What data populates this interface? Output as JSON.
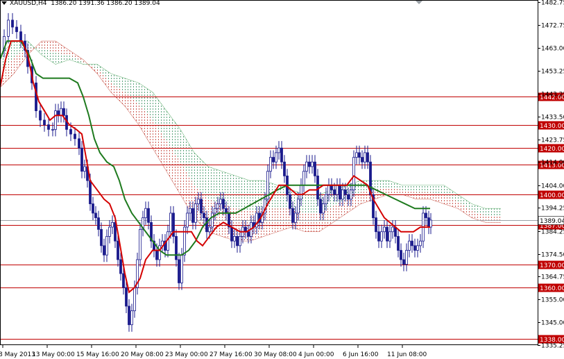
{
  "header": {
    "symbol": "XAUUSD,H4",
    "ohlc": "1386.20 1391.36 1386.20 1389.04"
  },
  "chart_data": {
    "type": "candlestick",
    "title": "XAUUSD,H4",
    "ylim": [
      1335.25,
      1482.75
    ],
    "price_ticks": [
      1482.75,
      1472.75,
      1463.0,
      1453.25,
      1443.25,
      1433.5,
      1423.75,
      1414.0,
      1404.0,
      1394.25,
      1384.25,
      1374.5,
      1364.75,
      1355.0,
      1345.0,
      1335.25
    ],
    "time_labels": [
      "8 May 2013",
      "13 May 00:00",
      "15 May 16:00",
      "20 May 08:00",
      "23 May 00:00",
      "27 May 16:00",
      "30 May 08:00",
      "4 Jun 00:00",
      "6 Jun 16:00",
      "11 Jun 08:00"
    ],
    "horizontal_levels": [
      {
        "price": 1442.0,
        "label": "1442.00"
      },
      {
        "price": 1430.0,
        "label": "1430.00"
      },
      {
        "price": 1420.0,
        "label": "1420.00"
      },
      {
        "price": 1413.0,
        "label": "1413.00"
      },
      {
        "price": 1400.0,
        "label": "1400.00"
      },
      {
        "price": 1387.0,
        "label": "1387.00"
      },
      {
        "price": 1370.0,
        "label": "1370.00"
      },
      {
        "price": 1360.0,
        "label": "1360.00"
      },
      {
        "price": 1338.0,
        "label": "1338.00"
      }
    ],
    "current_price": {
      "price": 1389.04,
      "label": "1389.04"
    },
    "close_path": [
      [
        0,
        1462
      ],
      [
        6,
        1468
      ],
      [
        12,
        1475
      ],
      [
        18,
        1472
      ],
      [
        24,
        1470
      ],
      [
        30,
        1466
      ],
      [
        36,
        1462
      ],
      [
        40,
        1455
      ],
      [
        46,
        1448
      ],
      [
        52,
        1436
      ],
      [
        58,
        1432
      ],
      [
        64,
        1430
      ],
      [
        70,
        1428
      ],
      [
        76,
        1428
      ],
      [
        80,
        1436
      ],
      [
        84,
        1434
      ],
      [
        88,
        1437
      ],
      [
        92,
        1434
      ],
      [
        96,
        1428
      ],
      [
        102,
        1426
      ],
      [
        108,
        1424
      ],
      [
        114,
        1420
      ],
      [
        118,
        1410
      ],
      [
        122,
        1412
      ],
      [
        126,
        1406
      ],
      [
        130,
        1396
      ],
      [
        134,
        1392
      ],
      [
        138,
        1390
      ],
      [
        142,
        1385
      ],
      [
        146,
        1378
      ],
      [
        150,
        1374
      ],
      [
        154,
        1382
      ],
      [
        158,
        1386
      ],
      [
        162,
        1388
      ],
      [
        166,
        1380
      ],
      [
        170,
        1372
      ],
      [
        174,
        1366
      ],
      [
        178,
        1360
      ],
      [
        182,
        1352
      ],
      [
        186,
        1344
      ],
      [
        190,
        1350
      ],
      [
        194,
        1360
      ],
      [
        198,
        1372
      ],
      [
        202,
        1385
      ],
      [
        206,
        1390
      ],
      [
        210,
        1394
      ],
      [
        214,
        1388
      ],
      [
        218,
        1380
      ],
      [
        222,
        1376
      ],
      [
        226,
        1372
      ],
      [
        230,
        1378
      ],
      [
        234,
        1380
      ],
      [
        238,
        1376
      ],
      [
        242,
        1384
      ],
      [
        246,
        1392
      ],
      [
        250,
        1382
      ],
      [
        254,
        1372
      ],
      [
        258,
        1362
      ],
      [
        262,
        1374
      ],
      [
        266,
        1386
      ],
      [
        270,
        1392
      ],
      [
        274,
        1394
      ],
      [
        278,
        1388
      ],
      [
        282,
        1396
      ],
      [
        286,
        1398
      ],
      [
        290,
        1392
      ],
      [
        294,
        1390
      ],
      [
        298,
        1384
      ],
      [
        302,
        1386
      ],
      [
        306,
        1392
      ],
      [
        310,
        1394
      ],
      [
        314,
        1396
      ],
      [
        318,
        1398
      ],
      [
        322,
        1394
      ],
      [
        326,
        1392
      ],
      [
        330,
        1386
      ],
      [
        334,
        1380
      ],
      [
        338,
        1382
      ],
      [
        342,
        1378
      ],
      [
        346,
        1382
      ],
      [
        350,
        1386
      ],
      [
        354,
        1384
      ],
      [
        358,
        1382
      ],
      [
        362,
        1388
      ],
      [
        366,
        1386
      ],
      [
        370,
        1392
      ],
      [
        374,
        1388
      ],
      [
        378,
        1392
      ],
      [
        382,
        1398
      ],
      [
        386,
        1410
      ],
      [
        390,
        1416
      ],
      [
        394,
        1414
      ],
      [
        398,
        1418
      ],
      [
        402,
        1420
      ],
      [
        406,
        1414
      ],
      [
        410,
        1408
      ],
      [
        414,
        1400
      ],
      [
        418,
        1394
      ],
      [
        422,
        1388
      ],
      [
        426,
        1392
      ],
      [
        430,
        1398
      ],
      [
        434,
        1404
      ],
      [
        438,
        1410
      ],
      [
        442,
        1414
      ],
      [
        446,
        1412
      ],
      [
        450,
        1414
      ],
      [
        454,
        1408
      ],
      [
        458,
        1398
      ],
      [
        462,
        1392
      ],
      [
        466,
        1396
      ],
      [
        470,
        1400
      ],
      [
        474,
        1404
      ],
      [
        478,
        1402
      ],
      [
        482,
        1400
      ],
      [
        486,
        1404
      ],
      [
        490,
        1398
      ],
      [
        494,
        1402
      ],
      [
        498,
        1400
      ],
      [
        502,
        1398
      ],
      [
        506,
        1402
      ],
      [
        510,
        1416
      ],
      [
        514,
        1418
      ],
      [
        518,
        1416
      ],
      [
        522,
        1414
      ],
      [
        526,
        1418
      ],
      [
        530,
        1414
      ],
      [
        534,
        1400
      ],
      [
        538,
        1390
      ],
      [
        542,
        1384
      ],
      [
        546,
        1380
      ],
      [
        550,
        1384
      ],
      [
        554,
        1386
      ],
      [
        558,
        1380
      ],
      [
        562,
        1384
      ],
      [
        566,
        1386
      ],
      [
        570,
        1382
      ],
      [
        574,
        1376
      ],
      [
        578,
        1372
      ],
      [
        582,
        1370
      ],
      [
        586,
        1376
      ],
      [
        590,
        1380
      ],
      [
        594,
        1378
      ],
      [
        598,
        1376
      ],
      [
        602,
        1378
      ],
      [
        606,
        1380
      ],
      [
        610,
        1392
      ],
      [
        614,
        1390
      ],
      [
        618,
        1386
      ],
      [
        621,
        1389
      ]
    ],
    "tenkan_path": [
      [
        0,
        1446
      ],
      [
        8,
        1458
      ],
      [
        16,
        1466
      ],
      [
        24,
        1466
      ],
      [
        32,
        1466
      ],
      [
        40,
        1460
      ],
      [
        48,
        1448
      ],
      [
        56,
        1440
      ],
      [
        64,
        1436
      ],
      [
        72,
        1432
      ],
      [
        80,
        1434
      ],
      [
        90,
        1434
      ],
      [
        100,
        1430
      ],
      [
        110,
        1428
      ],
      [
        118,
        1426
      ],
      [
        124,
        1416
      ],
      [
        130,
        1406
      ],
      [
        140,
        1402
      ],
      [
        150,
        1398
      ],
      [
        158,
        1396
      ],
      [
        166,
        1390
      ],
      [
        172,
        1380
      ],
      [
        180,
        1366
      ],
      [
        186,
        1358
      ],
      [
        194,
        1360
      ],
      [
        202,
        1364
      ],
      [
        210,
        1372
      ],
      [
        220,
        1376
      ],
      [
        230,
        1376
      ],
      [
        240,
        1380
      ],
      [
        250,
        1384
      ],
      [
        258,
        1384
      ],
      [
        266,
        1384
      ],
      [
        276,
        1384
      ],
      [
        284,
        1380
      ],
      [
        292,
        1378
      ],
      [
        302,
        1382
      ],
      [
        312,
        1386
      ],
      [
        322,
        1388
      ],
      [
        334,
        1386
      ],
      [
        346,
        1384
      ],
      [
        356,
        1384
      ],
      [
        366,
        1386
      ],
      [
        376,
        1390
      ],
      [
        386,
        1396
      ],
      [
        394,
        1400
      ],
      [
        402,
        1404
      ],
      [
        412,
        1404
      ],
      [
        420,
        1402
      ],
      [
        428,
        1400
      ],
      [
        436,
        1400
      ],
      [
        446,
        1402
      ],
      [
        456,
        1402
      ],
      [
        466,
        1404
      ],
      [
        478,
        1404
      ],
      [
        490,
        1404
      ],
      [
        500,
        1404
      ],
      [
        510,
        1408
      ],
      [
        520,
        1406
      ],
      [
        530,
        1404
      ],
      [
        538,
        1398
      ],
      [
        546,
        1394
      ],
      [
        554,
        1390
      ],
      [
        562,
        1388
      ],
      [
        570,
        1386
      ],
      [
        578,
        1384
      ],
      [
        586,
        1384
      ],
      [
        596,
        1384
      ],
      [
        606,
        1386
      ],
      [
        614,
        1386
      ],
      [
        620,
        1386
      ]
    ],
    "kijun_path": [
      [
        0,
        1458
      ],
      [
        10,
        1466
      ],
      [
        20,
        1466
      ],
      [
        30,
        1466
      ],
      [
        42,
        1460
      ],
      [
        52,
        1452
      ],
      [
        62,
        1450
      ],
      [
        74,
        1450
      ],
      [
        86,
        1450
      ],
      [
        100,
        1450
      ],
      [
        112,
        1448
      ],
      [
        120,
        1442
      ],
      [
        128,
        1434
      ],
      [
        136,
        1424
      ],
      [
        144,
        1418
      ],
      [
        154,
        1414
      ],
      [
        164,
        1412
      ],
      [
        172,
        1406
      ],
      [
        180,
        1398
      ],
      [
        190,
        1392
      ],
      [
        200,
        1388
      ],
      [
        210,
        1384
      ],
      [
        220,
        1380
      ],
      [
        230,
        1376
      ],
      [
        240,
        1374
      ],
      [
        252,
        1374
      ],
      [
        262,
        1374
      ],
      [
        272,
        1376
      ],
      [
        282,
        1380
      ],
      [
        292,
        1386
      ],
      [
        304,
        1390
      ],
      [
        316,
        1392
      ],
      [
        328,
        1392
      ],
      [
        340,
        1392
      ],
      [
        352,
        1394
      ],
      [
        364,
        1396
      ],
      [
        376,
        1398
      ],
      [
        388,
        1400
      ],
      [
        400,
        1402
      ],
      [
        414,
        1404
      ],
      [
        428,
        1404
      ],
      [
        442,
        1404
      ],
      [
        456,
        1404
      ],
      [
        470,
        1404
      ],
      [
        486,
        1404
      ],
      [
        500,
        1404
      ],
      [
        514,
        1404
      ],
      [
        528,
        1404
      ],
      [
        542,
        1402
      ],
      [
        556,
        1400
      ],
      [
        570,
        1398
      ],
      [
        584,
        1396
      ],
      [
        598,
        1394
      ],
      [
        612,
        1394
      ],
      [
        620,
        1394
      ]
    ],
    "cloud": {
      "green_top": [
        [
          0,
          1460
        ],
        [
          20,
          1466
        ],
        [
          40,
          1466
        ],
        [
          60,
          1460
        ],
        [
          80,
          1456
        ],
        [
          100,
          1458
        ],
        [
          120,
          1456
        ],
        [
          140,
          1456
        ],
        [
          160,
          1452
        ],
        [
          180,
          1450
        ],
        [
          200,
          1448
        ],
        [
          220,
          1444
        ],
        [
          240,
          1436
        ],
        [
          260,
          1428
        ],
        [
          280,
          1418
        ],
        [
          300,
          1412
        ],
        [
          320,
          1410
        ],
        [
          340,
          1408
        ],
        [
          360,
          1406
        ],
        [
          380,
          1406
        ],
        [
          400,
          1404
        ],
        [
          420,
          1402
        ],
        [
          440,
          1400
        ],
        [
          460,
          1400
        ],
        [
          480,
          1402
        ],
        [
          500,
          1404
        ],
        [
          520,
          1406
        ],
        [
          540,
          1406
        ],
        [
          560,
          1406
        ],
        [
          580,
          1404
        ],
        [
          600,
          1404
        ],
        [
          620,
          1404
        ],
        [
          640,
          1404
        ],
        [
          660,
          1400
        ],
        [
          680,
          1396
        ],
        [
          700,
          1394
        ],
        [
          722,
          1394
        ]
      ],
      "red_bottom": [
        [
          0,
          1446
        ],
        [
          20,
          1452
        ],
        [
          40,
          1460
        ],
        [
          60,
          1466
        ],
        [
          80,
          1466
        ],
        [
          100,
          1462
        ],
        [
          120,
          1458
        ],
        [
          140,
          1452
        ],
        [
          160,
          1444
        ],
        [
          180,
          1438
        ],
        [
          200,
          1430
        ],
        [
          220,
          1420
        ],
        [
          240,
          1410
        ],
        [
          260,
          1400
        ],
        [
          280,
          1390
        ],
        [
          300,
          1384
        ],
        [
          320,
          1382
        ],
        [
          340,
          1380
        ],
        [
          360,
          1380
        ],
        [
          380,
          1382
        ],
        [
          400,
          1384
        ],
        [
          420,
          1386
        ],
        [
          440,
          1384
        ],
        [
          460,
          1384
        ],
        [
          480,
          1388
        ],
        [
          500,
          1392
        ],
        [
          520,
          1396
        ],
        [
          540,
          1398
        ],
        [
          560,
          1400
        ],
        [
          580,
          1400
        ],
        [
          600,
          1398
        ],
        [
          620,
          1398
        ],
        [
          640,
          1396
        ],
        [
          660,
          1394
        ],
        [
          680,
          1390
        ],
        [
          700,
          1388
        ],
        [
          722,
          1388
        ]
      ]
    }
  }
}
